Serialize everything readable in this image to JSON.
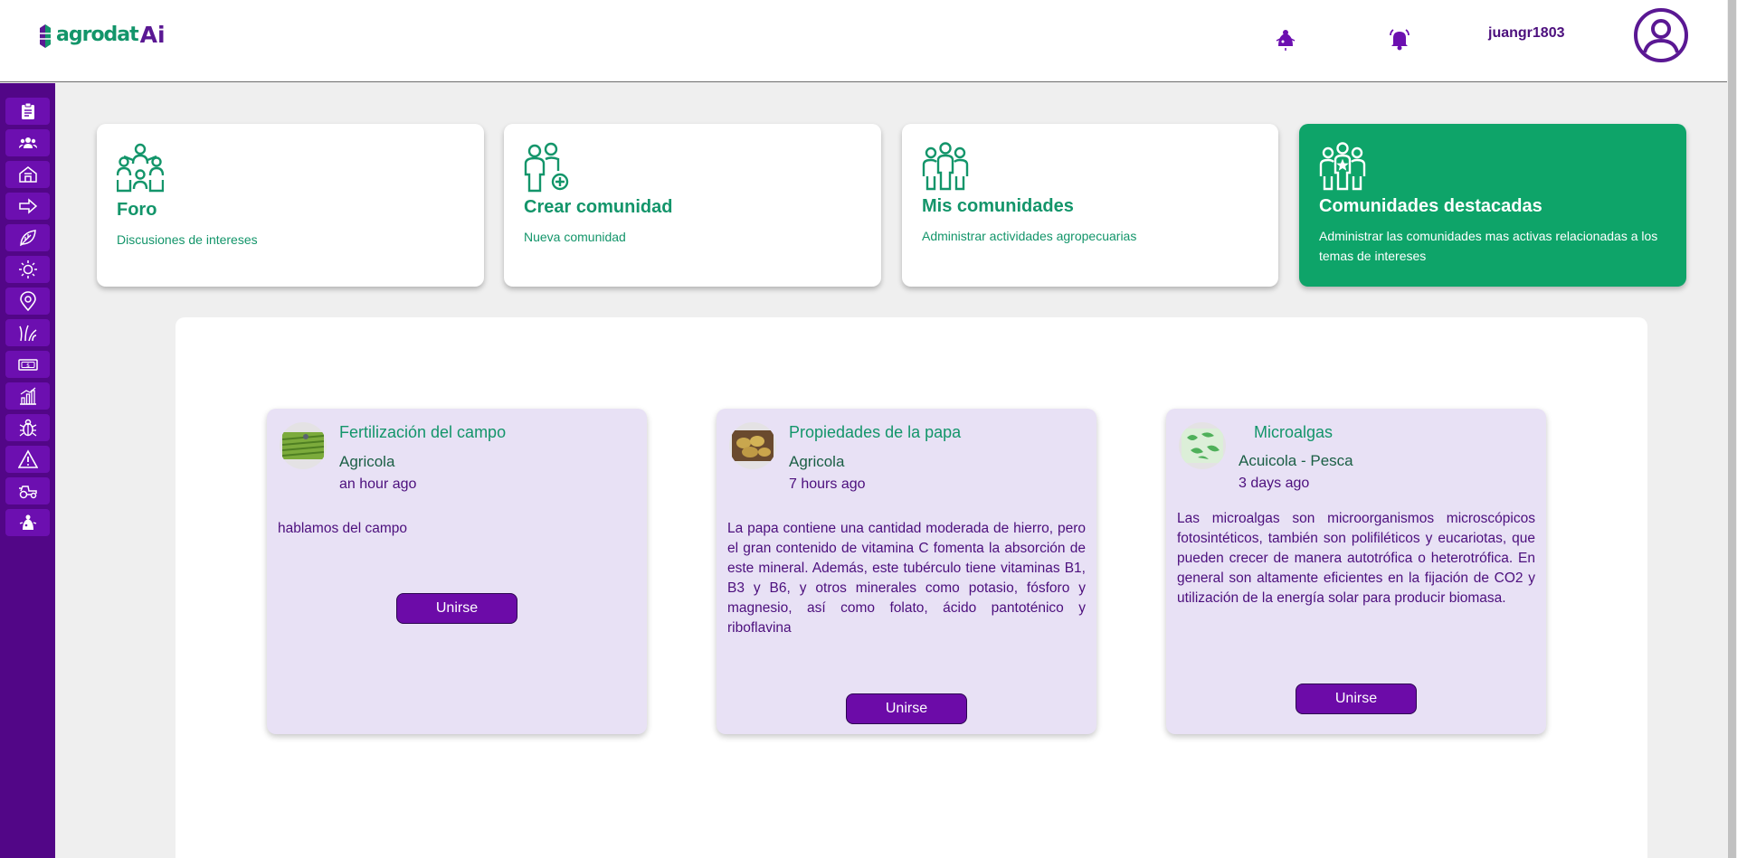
{
  "header": {
    "logo_text": "agrodat",
    "logo_ai": "Ai",
    "username": "juangr1803"
  },
  "sidebar": {
    "items": [
      {
        "icon": "clipboard-icon"
      },
      {
        "icon": "users-icon"
      },
      {
        "icon": "barn-icon"
      },
      {
        "icon": "arrow-right-icon"
      },
      {
        "icon": "leaf-icon"
      },
      {
        "icon": "sun-icon"
      },
      {
        "icon": "map-pin-icon"
      },
      {
        "icon": "grass-icon"
      },
      {
        "icon": "money-icon"
      },
      {
        "icon": "bar-chart-icon"
      },
      {
        "icon": "bug-icon"
      },
      {
        "icon": "warning-icon"
      },
      {
        "icon": "tractor-icon"
      },
      {
        "icon": "community-chat-icon"
      }
    ]
  },
  "top_cards": [
    {
      "title": "Foro",
      "subtitle": "Discusiones de intereses",
      "icon": "forum-icon"
    },
    {
      "title": "Crear comunidad",
      "subtitle": "Nueva comunidad",
      "icon": "add-community-icon"
    },
    {
      "title": "Mis comunidades",
      "subtitle": "Administrar actividades agropecuarias",
      "icon": "my-communities-icon"
    },
    {
      "title": "Comunidades destacadas",
      "subtitle": "Administrar las comunidades mas activas relacionadas a los temas de intereses",
      "icon": "featured-communities-icon"
    }
  ],
  "communities": [
    {
      "title": "Fertilización del campo",
      "category": "Agricola",
      "time": "an hour ago",
      "description": "hablamos del campo",
      "button": "Unirse"
    },
    {
      "title": "Propiedades de la papa",
      "category": "Agricola",
      "time": "7 hours ago",
      "description": "La papa contiene una cantidad moderada de hierro, pero el gran contenido de vitamina C fomenta la absorción de este mineral. Además, este tubérculo tiene vitaminas B1, B3 y B6, y otros minerales como potasio, fósforo y magnesio, así como folato, ácido pantoténico y riboflavina",
      "button": "Unirse"
    },
    {
      "title": "Microalgas",
      "category": "Acuicola - Pesca",
      "time": "3 days ago",
      "description": "Las microalgas son microorganismos microscópicos fotosintéticos, también son polifiléticos y eucariotas, que pueden crecer de manera autotrófica o heterotrófica. En general son altamente eficientes en la fijación de CO2 y utilización de la energía solar para producir biomasa.",
      "button": "Unirse"
    }
  ],
  "colors": {
    "brand_green": "#13956a",
    "brand_purple": "#520687",
    "card_bg": "#e8e1f5"
  }
}
